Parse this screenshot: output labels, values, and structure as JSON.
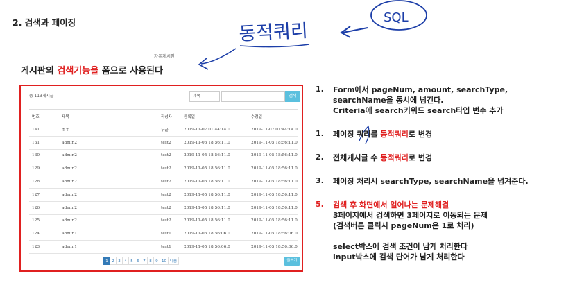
{
  "heading": "2. 검색과 페이징",
  "handwriting": {
    "dynamic_query": "동적쿼리",
    "sql": "SQL"
  },
  "board_label": "자유게시판",
  "subtitle": {
    "part1": "게시판의 ",
    "red": "검색기능을",
    "part2": " 폼으로 사용된다"
  },
  "board": {
    "total": "총 113게시글",
    "search_select": "제목",
    "search_button": "검색",
    "columns": [
      "번호",
      "제목",
      "작성자",
      "등록일",
      "수정일"
    ],
    "rows": [
      [
        "141",
        "ㅎㅎ",
        "두글",
        "2019-11-07 01:44:14.0",
        "2019-11-07 01:44:14.0"
      ],
      [
        "131",
        "admin2",
        "test2",
        "2019-11-05 18:56:11.0",
        "2019-11-05 18:56:11.0"
      ],
      [
        "130",
        "admin2",
        "test2",
        "2019-11-05 18:56:11.0",
        "2019-11-05 18:56:11.0"
      ],
      [
        "129",
        "admin2",
        "test2",
        "2019-11-05 18:56:11.0",
        "2019-11-05 18:56:11.0"
      ],
      [
        "128",
        "admin2",
        "test2",
        "2019-11-05 18:56:11.0",
        "2019-11-05 18:56:11.0"
      ],
      [
        "127",
        "admin2",
        "test2",
        "2019-11-05 18:56:11.0",
        "2019-11-05 18:56:11.0"
      ],
      [
        "126",
        "admin2",
        "test2",
        "2019-11-05 18:56:11.0",
        "2019-11-05 18:56:11.0"
      ],
      [
        "125",
        "admin2",
        "test2",
        "2019-11-05 18:56:11.0",
        "2019-11-05 18:56:11.0"
      ],
      [
        "124",
        "admin1",
        "test1",
        "2019-11-05 18:56:06.0",
        "2019-11-05 18:56:06.0"
      ],
      [
        "123",
        "admin1",
        "test1",
        "2019-11-05 18:56:06.0",
        "2019-11-05 18:56:06.0"
      ]
    ],
    "pages": [
      "1",
      "2",
      "3",
      "4",
      "5",
      "6",
      "7",
      "8",
      "9",
      "10",
      "다음"
    ],
    "write_button": "글쓰기"
  },
  "notes": {
    "n1": {
      "num": "1.",
      "line1": "Form에서 pageNum, amount, searchType,",
      "line2": "searchName을 동시에 넘긴다.",
      "line3": "Criteria에 search키워드 search타입 변수 추가"
    },
    "n2": {
      "num": "1.",
      "pre": "페이징 쿼리를 ",
      "red": "동적쿼리",
      "post": "로 변경"
    },
    "n3": {
      "num": "2.",
      "pre": "전체게시글 수 ",
      "red": "동적쿼리",
      "post": "로 변경"
    },
    "n4": {
      "num": "3.",
      "text": "페이징 처리시 searchType, searchName을 넘겨준다."
    },
    "n5": {
      "num": "5.",
      "red": "검색 후 화면에서 일어나는 문제해결",
      "line2": "3페이지에서 검색하면 3페이지로 이동되는 문제",
      "line3": "(검색버튼 클릭시 pageNum은 1로 처리)",
      "line4": "select박스에 검색 조건이 남게 처리한다",
      "line5": "input박스에 검색 단어가 남게 처리한다"
    }
  },
  "colors": {
    "accent_red": "#e02020",
    "handwriting_blue": "#1c3ea8",
    "button_blue": "#5bc0de",
    "page_active": "#337ab7"
  }
}
